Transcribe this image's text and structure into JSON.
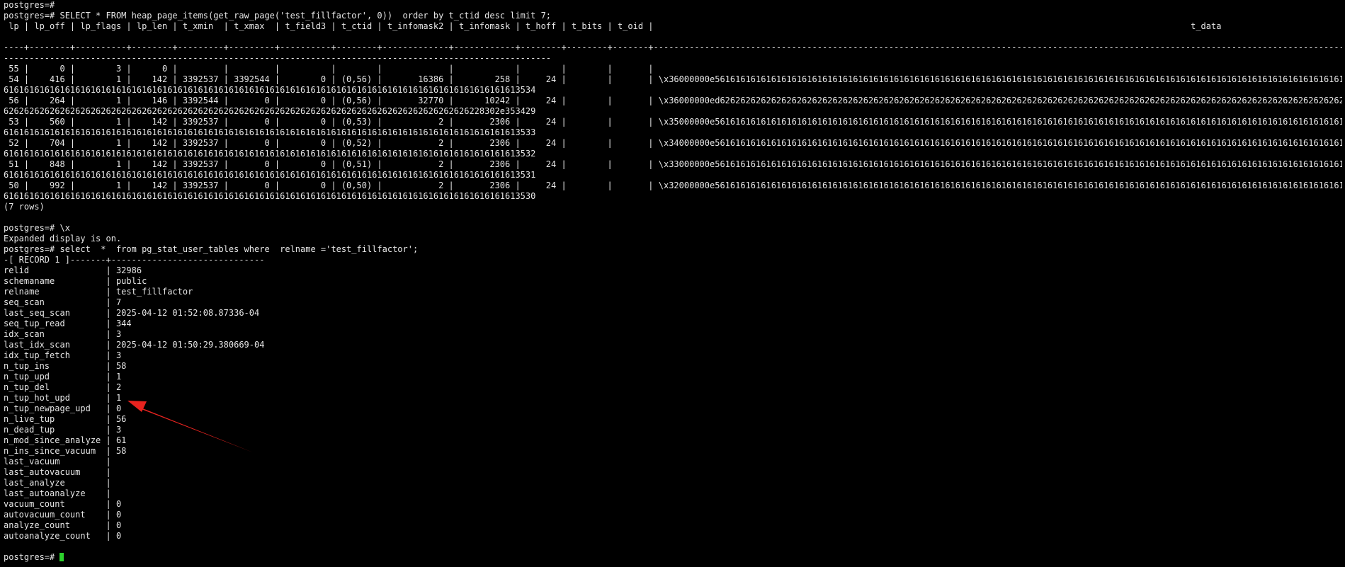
{
  "lines": [
    "postgres=#",
    "postgres=# SELECT * FROM heap_page_items(get_raw_page('test_fillfactor', 0))  order by t_ctid desc limit 7;",
    " lp | lp_off | lp_flags | lp_len | t_xmin  | t_xmax  | t_field3 | t_ctid | t_infomask2 | t_infomask | t_hoff | t_bits | t_oid |                                                                                                         t_data",
    "",
    "----+--------+----------+--------+---------+---------+----------+--------+-------------+------------+--------+--------+-------+----------------------------------------------------------------------------------------------------------------------------------------------------",
    "-----------------------------------------------------------------------------------------------------------",
    " 55 |      0 |        3 |      0 |         |         |          |        |             |            |        |        |       |",
    " 54 |    416 |        1 |    142 | 3392537 | 3392544 |        0 | (0,56) |       16386 |        258 |     24 |        |       | \\x36000000e56161616161616161616161616161616161616161616161616161616161616161616161616161616161616161616161616161616161616161616161616161",
    "61616161616161616161616161616161616161616161616161616161616161616161616161616161616161616161616161613534",
    " 56 |    264 |        1 |    146 | 3392544 |       0 |        0 | (0,56) |       32770 |      10242 |     24 |        |       | \\x36000000ed62626262626262626262626262626262626262626262626262626262626262626262626262626262626262626262626262626262626262626262626262",
    "6262626262626262626262626262626262626262626262626262626262626262626262626262626262626262626228302e353429",
    " 53 |    560 |        1 |    142 | 3392537 |       0 |        0 | (0,53) |           2 |       2306 |     24 |        |       | \\x35000000e56161616161616161616161616161616161616161616161616161616161616161616161616161616161616161616161616161616161616161616161616161",
    "61616161616161616161616161616161616161616161616161616161616161616161616161616161616161616161616161613533",
    " 52 |    704 |        1 |    142 | 3392537 |       0 |        0 | (0,52) |           2 |       2306 |     24 |        |       | \\x34000000e56161616161616161616161616161616161616161616161616161616161616161616161616161616161616161616161616161616161616161616161616161",
    "61616161616161616161616161616161616161616161616161616161616161616161616161616161616161616161616161613532",
    " 51 |    848 |        1 |    142 | 3392537 |       0 |        0 | (0,51) |           2 |       2306 |     24 |        |       | \\x33000000e56161616161616161616161616161616161616161616161616161616161616161616161616161616161616161616161616161616161616161616161616161",
    "61616161616161616161616161616161616161616161616161616161616161616161616161616161616161616161616161613531",
    " 50 |    992 |        1 |    142 | 3392537 |       0 |        0 | (0,50) |           2 |       2306 |     24 |        |       | \\x32000000e56161616161616161616161616161616161616161616161616161616161616161616161616161616161616161616161616161616161616161616161616161",
    "61616161616161616161616161616161616161616161616161616161616161616161616161616161616161616161616161613530",
    "(7 rows)",
    "",
    "postgres=# \\x",
    "Expanded display is on.",
    "postgres=# select  *  from pg_stat_user_tables where  relname ='test_fillfactor';",
    "-[ RECORD 1 ]-------+------------------------------",
    "relid               | 32986",
    "schemaname          | public",
    "relname             | test_fillfactor",
    "seq_scan            | 7",
    "last_seq_scan       | 2025-04-12 01:52:08.87336-04",
    "seq_tup_read        | 344",
    "idx_scan            | 3",
    "last_idx_scan       | 2025-04-12 01:50:29.380669-04",
    "idx_tup_fetch       | 3",
    "n_tup_ins           | 58",
    "n_tup_upd           | 1",
    "n_tup_del           | 2",
    "n_tup_hot_upd       | 1",
    "n_tup_newpage_upd   | 0",
    "n_live_tup          | 56",
    "n_dead_tup          | 3",
    "n_mod_since_analyze | 61",
    "n_ins_since_vacuum  | 58",
    "last_vacuum         |",
    "last_autovacuum     |",
    "last_analyze        |",
    "last_autoanalyze    |",
    "vacuum_count        | 0",
    "autovacuum_count    | 0",
    "analyze_count       | 0",
    "autoanalyze_count   | 0",
    ""
  ],
  "prompt": "postgres=# ",
  "colors": {
    "background": "#000000",
    "text": "#e6e6e6",
    "cursor": "#2cd12c",
    "arrow": "#e8231f"
  }
}
